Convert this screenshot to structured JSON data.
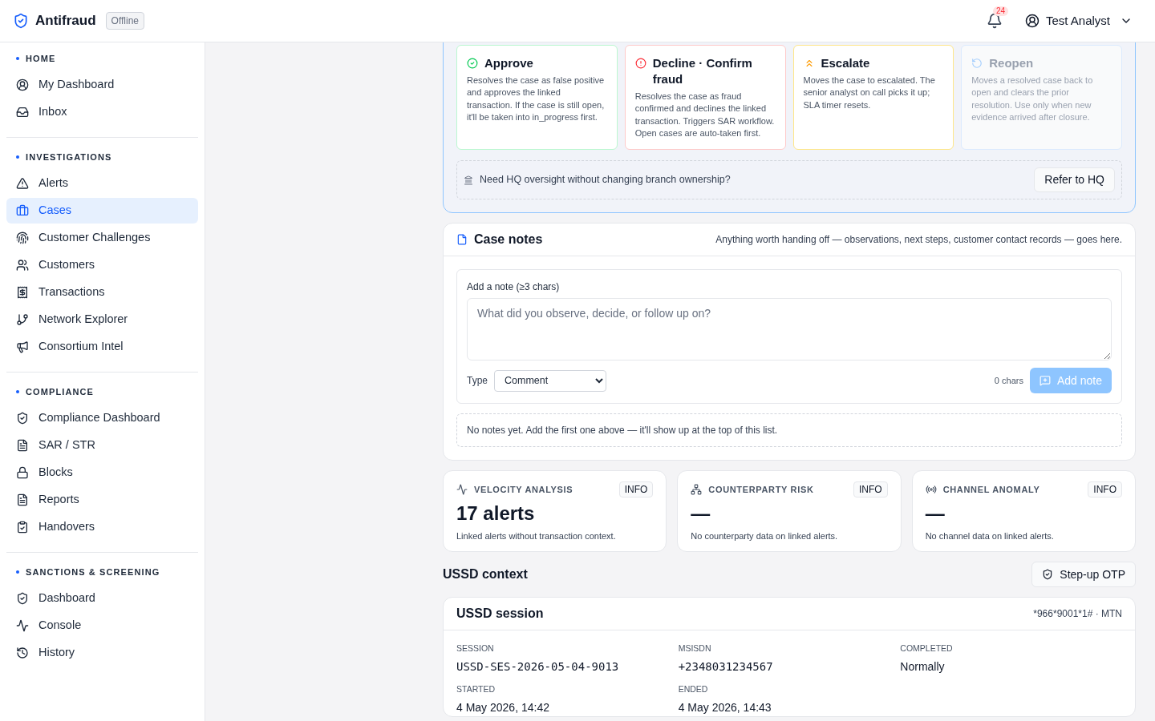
{
  "header": {
    "brand": "Antifraud",
    "status": "Offline",
    "notification_count": "24",
    "user": "Test Analyst"
  },
  "sidebar": {
    "sections": [
      {
        "title": "HOME",
        "items": [
          {
            "label": "My Dashboard",
            "selected": false
          },
          {
            "label": "Inbox",
            "selected": false
          }
        ]
      },
      {
        "title": "INVESTIGATIONS",
        "items": [
          {
            "label": "Alerts",
            "selected": false
          },
          {
            "label": "Cases",
            "selected": true
          },
          {
            "label": "Customer Challenges",
            "selected": false
          },
          {
            "label": "Customers",
            "selected": false
          },
          {
            "label": "Transactions",
            "selected": false
          },
          {
            "label": "Network Explorer",
            "selected": false
          },
          {
            "label": "Consortium Intel",
            "selected": false
          }
        ]
      },
      {
        "title": "COMPLIANCE",
        "items": [
          {
            "label": "Compliance Dashboard",
            "selected": false
          },
          {
            "label": "SAR / STR",
            "selected": false
          },
          {
            "label": "Blocks",
            "selected": false
          },
          {
            "label": "Reports",
            "selected": false
          },
          {
            "label": "Handovers",
            "selected": false
          }
        ]
      },
      {
        "title": "SANCTIONS & SCREENING",
        "items": [
          {
            "label": "Dashboard",
            "selected": false
          },
          {
            "label": "Console",
            "selected": false
          },
          {
            "label": "History",
            "selected": false
          }
        ]
      }
    ]
  },
  "actions": [
    {
      "title": "Approve",
      "description": "Resolves the case as false positive and approves the linked transaction. If the case is still open, it'll be taken into in_progress first.",
      "color": "#bbf7d0",
      "disabled": false
    },
    {
      "title": "Decline · Confirm fraud",
      "description": "Resolves the case as fraud confirmed and declines the linked transaction. Triggers SAR workflow. Open cases are auto-taken first.",
      "color": "#fecaca",
      "disabled": false
    },
    {
      "title": "Escalate",
      "description": "Moves the case to escalated. The senior analyst on call picks it up; SLA timer resets.",
      "color": "#fde68a",
      "disabled": false
    },
    {
      "title": "Reopen",
      "description": "Moves a resolved case back to open and clears the prior resolution. Use only when new evidence arrived after closure.",
      "color": "#dbeafe",
      "disabled": true
    }
  ],
  "refer": {
    "text": "Need HQ oversight without changing branch ownership?",
    "button": "Refer to HQ"
  },
  "notes": {
    "title": "Case notes",
    "subtitle": "Anything worth handing off — observations, next steps, customer contact records — goes here.",
    "label": "Add a note (≥3 chars)",
    "placeholder": "What did you observe, decide, or follow up on?",
    "type_label": "Type",
    "type_value": "Comment",
    "char_count": "0 chars",
    "add_button": {
      "label": "Add note",
      "disabled": true
    },
    "empty_text": "No notes yet. Add the first one above — it'll show up at the top of this list."
  },
  "metrics": [
    {
      "title": "VELOCITY ANALYSIS",
      "badge": "INFO",
      "value": "17 alerts",
      "caption": "Linked alerts without transaction context."
    },
    {
      "title": "COUNTERPARTY RISK",
      "badge": "INFO",
      "value": "—",
      "caption": "No counterparty data on linked alerts."
    },
    {
      "title": "CHANNEL ANOMALY",
      "badge": "INFO",
      "value": "—",
      "caption": "No channel data on linked alerts."
    }
  ],
  "ussd": {
    "heading": "USSD context",
    "button": "Step-up OTP",
    "session": {
      "title": "USSD session",
      "code": "*966*9001*1# · MTN",
      "fields": [
        {
          "label": "SESSION",
          "value": "USSD-SES-2026-05-04-9013",
          "kind": "code"
        },
        {
          "label": "MSISDN",
          "value": "+2348031234567",
          "kind": "code"
        },
        {
          "label": "COMPLETED",
          "value": "Normally",
          "kind": "text"
        },
        {
          "label": "STARTED",
          "value": "4 May 2026, 14:42",
          "kind": "text"
        },
        {
          "label": "ENDED",
          "value": "4 May 2026, 14:43",
          "kind": "text"
        }
      ]
    }
  }
}
